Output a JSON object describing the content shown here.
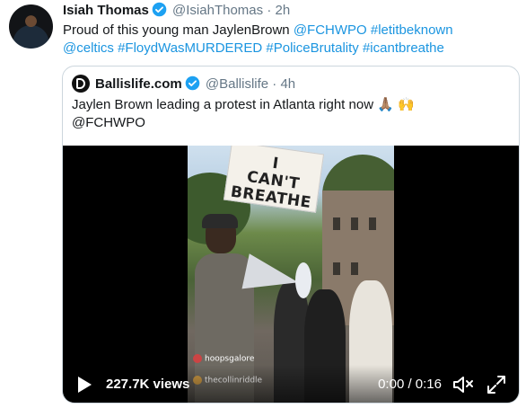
{
  "tweet": {
    "author_name": "Isiah Thomas",
    "author_handle": "@IsiahThomas",
    "separator": "·",
    "time": "2h",
    "text_plain": "Proud of this young man JaylenBrown ",
    "links_line1": [
      "@FCHWPO",
      "#letitbeknown"
    ],
    "links_line2": [
      "@celtics",
      "#FloydWasMURDERED",
      "#PoliceBrutality",
      "#icantbreathe"
    ]
  },
  "quote": {
    "author_name": "Ballislife.com",
    "author_handle": "@Ballislife",
    "separator": "·",
    "time": "4h",
    "text": "Jaylen Brown leading a protest in Atlanta right now 🙏🏽 🙌",
    "mention": "@FCHWPO"
  },
  "video": {
    "sign_line1": "I",
    "sign_line2": "CAN'T",
    "sign_line3": "BREATHE",
    "overlay_user1": "hoopsgalore",
    "overlay_user2": "thecollinriddle",
    "views": "227.7K views",
    "time_display": "0:00 / 0:16"
  },
  "colors": {
    "link": "#1b95e0",
    "verified": "#1da1f2",
    "secondary_text": "#657786",
    "border": "#ccd6dd"
  },
  "icons": [
    "verified-badge-icon",
    "ballislife-logo-icon",
    "play-icon",
    "volume-icon",
    "fullscreen-icon"
  ]
}
